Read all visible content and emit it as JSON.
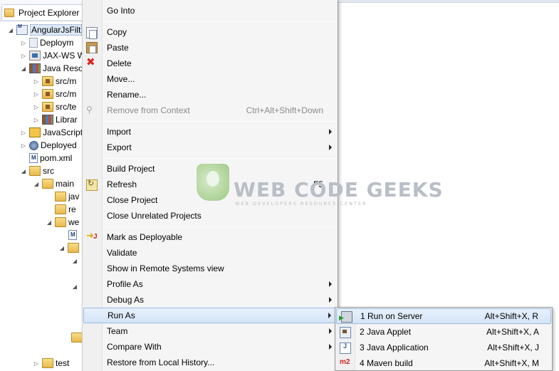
{
  "explorer": {
    "tab_label": "Project Explorer",
    "tab_close": "✕",
    "tree": [
      {
        "label": "AngularJsFilt",
        "icon": "project-icon",
        "selected": true
      },
      {
        "label": "Deploym",
        "icon": "deployment-descriptor-icon"
      },
      {
        "label": "JAX-WS W",
        "icon": "web-services-icon"
      },
      {
        "label": "Java Reso",
        "icon": "java-resources-icon"
      },
      {
        "label": "src/m",
        "icon": "package-folder-icon"
      },
      {
        "label": "src/m",
        "icon": "package-folder-icon"
      },
      {
        "label": "src/te",
        "icon": "package-folder-icon"
      },
      {
        "label": "Librar",
        "icon": "library-icon"
      },
      {
        "label": "JavaScript",
        "icon": "javascript-resources-icon"
      },
      {
        "label": "Deployed",
        "icon": "deployed-resources-icon"
      },
      {
        "label": "pom.xml",
        "icon": "xml-file-icon"
      },
      {
        "label": "src",
        "icon": "folder-icon"
      },
      {
        "label": "main",
        "icon": "folder-icon"
      },
      {
        "label": "jav",
        "icon": "folder-icon"
      },
      {
        "label": "re",
        "icon": "folder-icon"
      },
      {
        "label": "we",
        "icon": "folder-icon"
      },
      {
        "label": "test",
        "icon": "folder-icon"
      }
    ]
  },
  "context_menu": {
    "go_into": "Go Into",
    "copy": "Copy",
    "paste": "Paste",
    "delete": "Delete",
    "move": "Move...",
    "rename": "Rename...",
    "remove_from_context": "Remove from Context",
    "remove_from_context_shortcut": "Ctrl+Alt+Shift+Down",
    "import": "Import",
    "export": "Export",
    "build_project": "Build Project",
    "refresh": "Refresh",
    "refresh_shortcut": "F5",
    "close_project": "Close Project",
    "close_unrelated": "Close Unrelated Projects",
    "mark_deployable": "Mark as Deployable",
    "validate": "Validate",
    "show_remote": "Show in Remote Systems view",
    "profile_as": "Profile As",
    "debug_as": "Debug As",
    "run_as": "Run As",
    "team": "Team",
    "compare_with": "Compare With",
    "restore_history": "Restore from Local History..."
  },
  "run_as_submenu": {
    "items": [
      {
        "label": "1 Run on Server",
        "shortcut": "Alt+Shift+X, R"
      },
      {
        "label": "2 Java Applet",
        "shortcut": "Alt+Shift+X, A"
      },
      {
        "label": "3 Java Application",
        "shortcut": "Alt+Shift+X, J"
      },
      {
        "label": "4 Maven build",
        "shortcut": "Alt+Shift+X, M"
      }
    ],
    "maven_icon_text": "m2"
  },
  "watermark": {
    "title": "WEB CODE GEEKS",
    "subtitle": "WEB DEVELOPERS RESOURCE CENTER"
  }
}
